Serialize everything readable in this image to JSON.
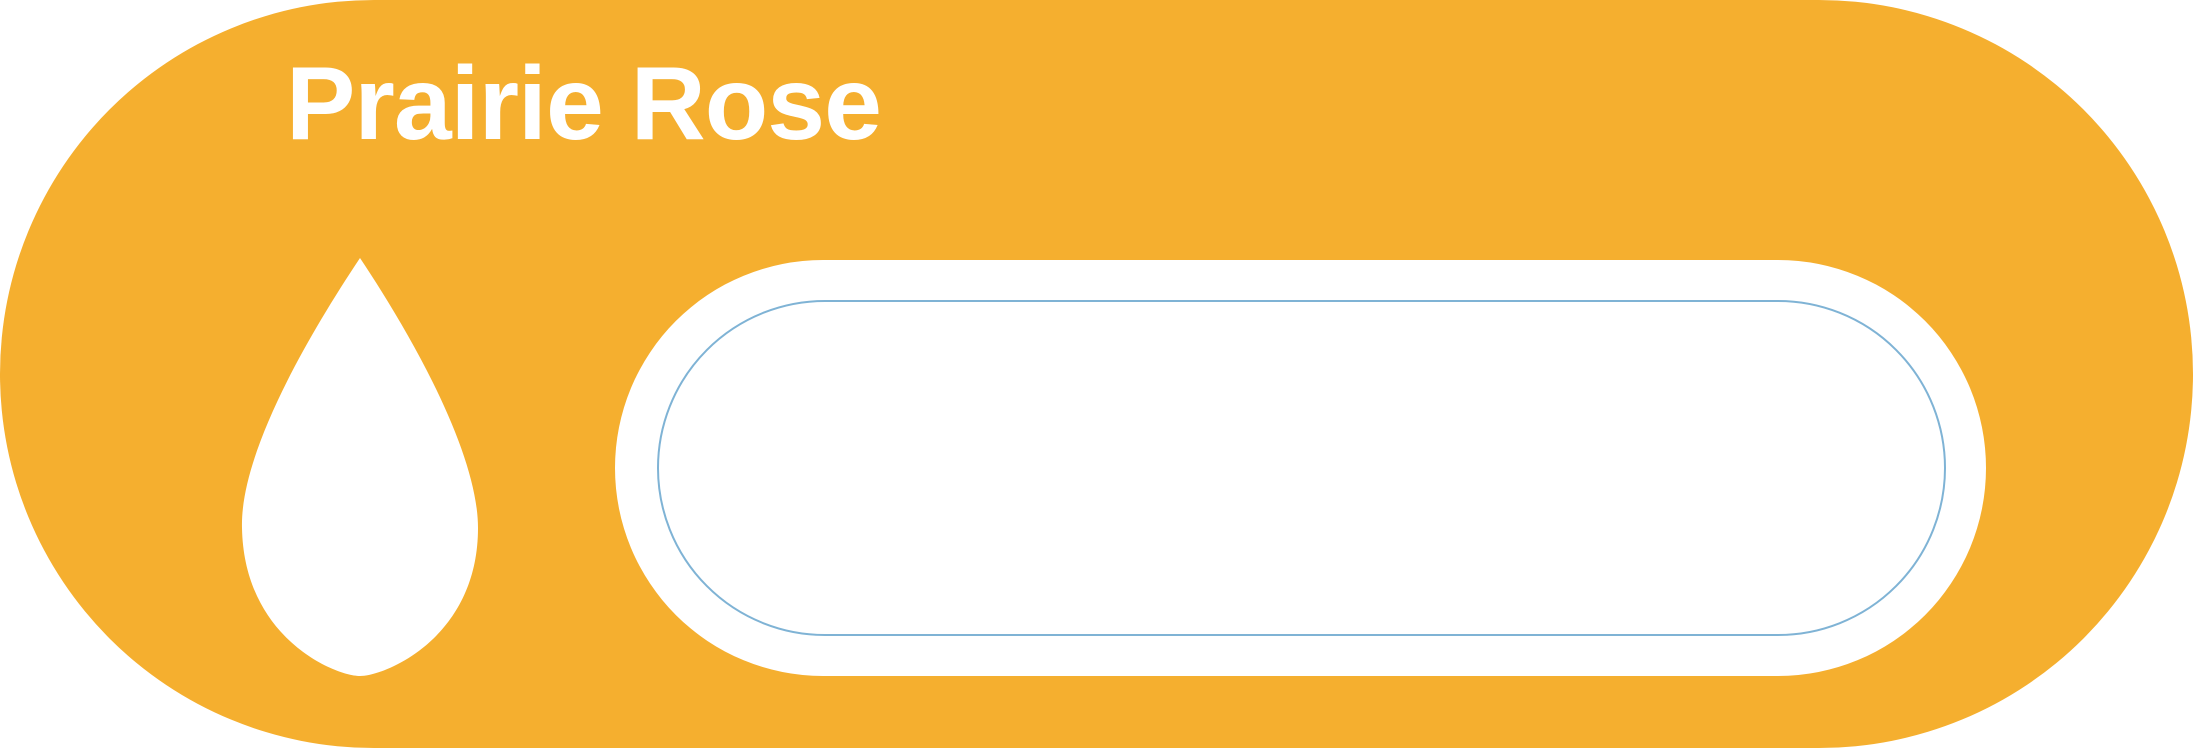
{
  "card": {
    "title": "Prairie Rose",
    "background_color": "#F5AF2F",
    "icon": "water-drop-icon",
    "field_border_color": "#7FB3D5"
  }
}
